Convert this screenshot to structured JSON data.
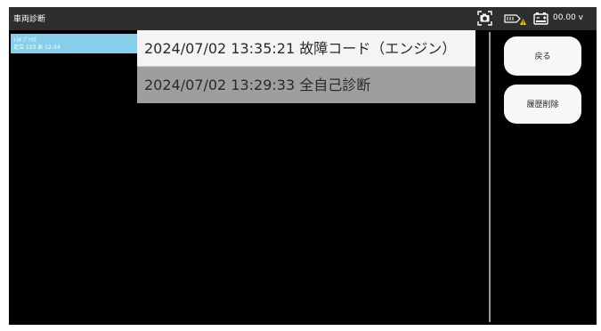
{
  "app": {
    "title": "車両診断"
  },
  "status": {
    "voltage": "00.00 v",
    "icons": [
      "camera-icon",
      "vci-warning-icon",
      "battery-icon"
    ],
    "warning_color": "#f5d000"
  },
  "vehicle": {
    "model": "ﾄﾖﾀ ﾌﾟﾘｳｽ",
    "plate": "足立 123 あ 12-34",
    "card_color": "#87ceeb"
  },
  "history": {
    "items": [
      {
        "label": "2024/07/02 13:35:21 故障コード（エンジン）"
      },
      {
        "label": "2024/07/02 13:29:33 全自己診断"
      }
    ]
  },
  "actions": {
    "back_label": "戻る",
    "delete_label": "履歴削除"
  }
}
